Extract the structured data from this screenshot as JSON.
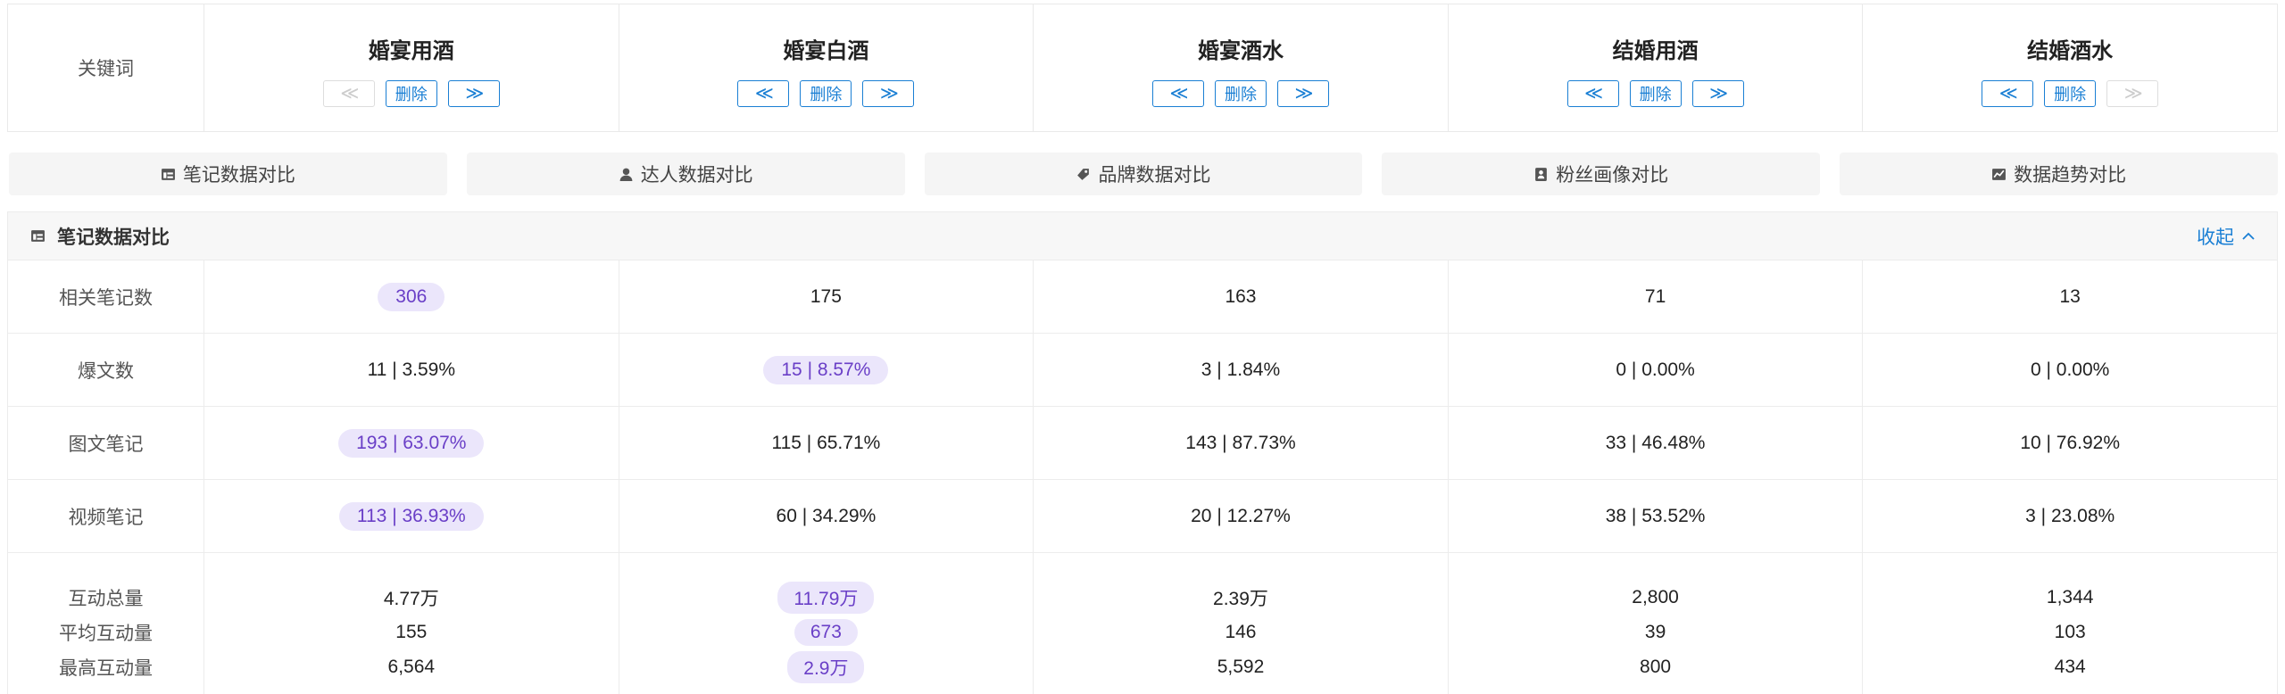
{
  "keyword_header": {
    "label": "关键词",
    "delete_label": "删除",
    "prev_glyph": "≪",
    "next_glyph": "≫",
    "keywords": [
      {
        "name": "婚宴用酒",
        "prev_disabled": true,
        "next_disabled": false
      },
      {
        "name": "婚宴白酒",
        "prev_disabled": false,
        "next_disabled": false
      },
      {
        "name": "婚宴酒水",
        "prev_disabled": false,
        "next_disabled": false
      },
      {
        "name": "结婚用酒",
        "prev_disabled": false,
        "next_disabled": false
      },
      {
        "name": "结婚酒水",
        "prev_disabled": false,
        "next_disabled": true
      }
    ]
  },
  "tabs": [
    {
      "label": "笔记数据对比",
      "icon": "note-card-icon"
    },
    {
      "label": "达人数据对比",
      "icon": "user-icon"
    },
    {
      "label": "品牌数据对比",
      "icon": "brand-tag-icon"
    },
    {
      "label": "粉丝画像对比",
      "icon": "portrait-icon"
    },
    {
      "label": "数据趋势对比",
      "icon": "trend-chart-icon"
    }
  ],
  "section": {
    "title": "笔记数据对比",
    "collapse_label": "收起",
    "highlight_color": "#6a3fc7",
    "rows": [
      {
        "label": "相关笔记数",
        "values": [
          "306",
          "175",
          "163",
          "71",
          "13"
        ],
        "highlight": 0
      },
      {
        "label": "爆文数",
        "values": [
          "11 | 3.59%",
          "15 | 8.57%",
          "3 | 1.84%",
          "0 | 0.00%",
          "0 | 0.00%"
        ],
        "highlight": 1
      },
      {
        "label": "图文笔记",
        "values": [
          "193 | 63.07%",
          "115 | 65.71%",
          "143 | 87.73%",
          "33 | 46.48%",
          "10 | 76.92%"
        ],
        "highlight": 0
      },
      {
        "label": "视频笔记",
        "values": [
          "113 | 36.93%",
          "60 | 34.29%",
          "20 | 12.27%",
          "38 | 53.52%",
          "3 | 23.08%"
        ],
        "highlight": 0
      }
    ],
    "interaction": {
      "labels": [
        "互动总量",
        "平均互动量",
        "最高互动量"
      ],
      "highlight": 1,
      "columns": [
        [
          "4.77万",
          "155",
          "6,564"
        ],
        [
          "11.79万",
          "673",
          "2.9万"
        ],
        [
          "2.39万",
          "146",
          "5,592"
        ],
        [
          "2,800",
          "39",
          "800"
        ],
        [
          "1,344",
          "103",
          "434"
        ]
      ]
    }
  }
}
